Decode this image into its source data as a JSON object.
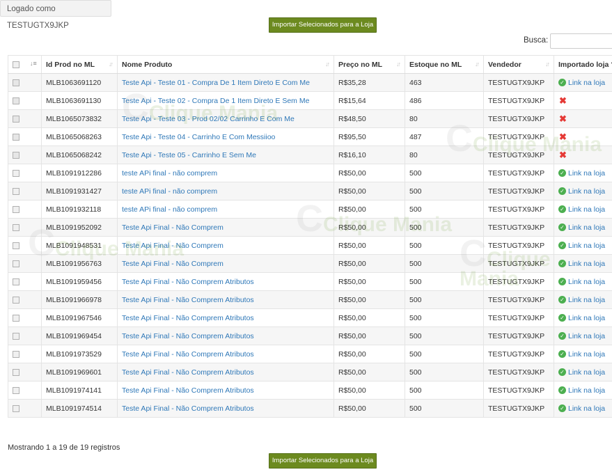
{
  "session": {
    "logged_in_label": "Logado como TESTUGTX9JKP"
  },
  "actions": {
    "import_label": "Importar Selecionados para a Loja"
  },
  "search": {
    "label": "Busca:",
    "value": ""
  },
  "table": {
    "columns": [
      "Id Prod no ML",
      "Nome Produto",
      "Preço no ML",
      "Estoque no ML",
      "Vendedor",
      "Importado loja ?"
    ],
    "rows": [
      {
        "id": "MLB1063691120",
        "name": "Teste Api - Teste 01 - Compra De 1 Item Direto E Com Me",
        "price": "R$35,28",
        "stock": "463",
        "seller": "TESTUGTX9JKP",
        "imported": true
      },
      {
        "id": "MLB1063691130",
        "name": "Teste Api - Teste 02 - Compra De 1 Item Direto E Sem Me",
        "price": "R$15,64",
        "stock": "486",
        "seller": "TESTUGTX9JKP",
        "imported": false
      },
      {
        "id": "MLB1065073832",
        "name": "Teste Api - Teste 03 - Prod 02/02 Carrinho E Com Me",
        "price": "R$48,50",
        "stock": "80",
        "seller": "TESTUGTX9JKP",
        "imported": false
      },
      {
        "id": "MLB1065068263",
        "name": "Teste Api - Teste 04 - Carrinho E Com Messiioo",
        "price": "R$95,50",
        "stock": "487",
        "seller": "TESTUGTX9JKP",
        "imported": false
      },
      {
        "id": "MLB1065068242",
        "name": "Teste Api - Teste 05 - Carrinho E Sem Me",
        "price": "R$16,10",
        "stock": "80",
        "seller": "TESTUGTX9JKP",
        "imported": false
      },
      {
        "id": "MLB1091912286",
        "name": "teste APi final - não comprem",
        "price": "R$50,00",
        "stock": "500",
        "seller": "TESTUGTX9JKP",
        "imported": true
      },
      {
        "id": "MLB1091931427",
        "name": "teste APi final - não comprem",
        "price": "R$50,00",
        "stock": "500",
        "seller": "TESTUGTX9JKP",
        "imported": true
      },
      {
        "id": "MLB1091932118",
        "name": "teste APi final - não comprem",
        "price": "R$50,00",
        "stock": "500",
        "seller": "TESTUGTX9JKP",
        "imported": true
      },
      {
        "id": "MLB1091952092",
        "name": "Teste Api Final - Não Comprem",
        "price": "R$50,00",
        "stock": "500",
        "seller": "TESTUGTX9JKP",
        "imported": true
      },
      {
        "id": "MLB1091948531",
        "name": "Teste Api Final - Não Comprem",
        "price": "R$50,00",
        "stock": "500",
        "seller": "TESTUGTX9JKP",
        "imported": true
      },
      {
        "id": "MLB1091956763",
        "name": "Teste Api Final - Não Comprem",
        "price": "R$50,00",
        "stock": "500",
        "seller": "TESTUGTX9JKP",
        "imported": true
      },
      {
        "id": "MLB1091959456",
        "name": "Teste Api Final - Não Comprem Atributos",
        "price": "R$50,00",
        "stock": "500",
        "seller": "TESTUGTX9JKP",
        "imported": true
      },
      {
        "id": "MLB1091966978",
        "name": "Teste Api Final - Não Comprem Atributos",
        "price": "R$50,00",
        "stock": "500",
        "seller": "TESTUGTX9JKP",
        "imported": true
      },
      {
        "id": "MLB1091967546",
        "name": "Teste Api Final - Não Comprem Atributos",
        "price": "R$50,00",
        "stock": "500",
        "seller": "TESTUGTX9JKP",
        "imported": true
      },
      {
        "id": "MLB1091969454",
        "name": "Teste Api Final - Não Comprem Atributos",
        "price": "R$50,00",
        "stock": "500",
        "seller": "TESTUGTX9JKP",
        "imported": true
      },
      {
        "id": "MLB1091973529",
        "name": "Teste Api Final - Não Comprem Atributos",
        "price": "R$50,00",
        "stock": "500",
        "seller": "TESTUGTX9JKP",
        "imported": true
      },
      {
        "id": "MLB1091969601",
        "name": "Teste Api Final - Não Comprem Atributos",
        "price": "R$50,00",
        "stock": "500",
        "seller": "TESTUGTX9JKP",
        "imported": true
      },
      {
        "id": "MLB1091974141",
        "name": "Teste Api Final - Não Comprem Atributos",
        "price": "R$50,00",
        "stock": "500",
        "seller": "TESTUGTX9JKP",
        "imported": true
      },
      {
        "id": "MLB1091974514",
        "name": "Teste Api Final - Não Comprem Atributos",
        "price": "R$50,00",
        "stock": "500",
        "seller": "TESTUGTX9JKP",
        "imported": true
      }
    ],
    "imported_link_label": "Link na loja",
    "icons": {
      "imported": "check-circle-icon",
      "not_imported": "red-x-icon",
      "sort": "sort-arrows-icon",
      "checkbox": "checkbox-icon"
    }
  },
  "footer": {
    "info": "Mostrando 1 a 19 de 19 registros"
  },
  "watermark": {
    "brand": "Clique Mania"
  },
  "colors": {
    "button_bg": "#6c8a1f",
    "link": "#2f78b8",
    "ok": "#4caf50",
    "error": "#e53935"
  }
}
